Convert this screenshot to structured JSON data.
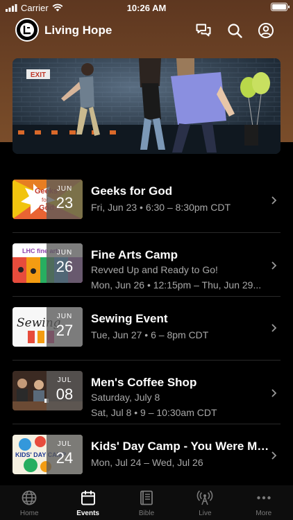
{
  "status_bar": {
    "carrier": "Carrier",
    "time": "10:26 AM"
  },
  "app": {
    "title": "Living Hope"
  },
  "colors": {
    "header_brown": "#6e4426",
    "background": "#000000",
    "muted_text": "#a8a8a8",
    "active_tab": "#ffffff"
  },
  "hero": {
    "exit_sign": "EXIT"
  },
  "events": [
    {
      "title": "Geeks for God",
      "month": "JUN",
      "day": "23",
      "lines": [
        "Fri, Jun 23 • 6:30 – 8:30pm CDT"
      ],
      "thumb_text": "Geeks for God"
    },
    {
      "title": "Fine Arts Camp",
      "month": "JUN",
      "day": "26",
      "lines": [
        "Revved Up and Ready to Go!",
        "Mon, Jun 26 • 12:15pm – Thu, Jun 29..."
      ],
      "thumb_text": "LHC fine arts"
    },
    {
      "title": "Sewing Event",
      "month": "JUN",
      "day": "27",
      "lines": [
        "Tue, Jun 27 • 6 – 8pm CDT"
      ],
      "thumb_text": "Sewing"
    },
    {
      "title": "Men's Coffee Shop",
      "month": "JUL",
      "day": "08",
      "lines": [
        "Saturday, July 8",
        "Sat, Jul 8 • 9 – 10:30am CDT"
      ],
      "thumb_text": ""
    },
    {
      "title": "Kids' Day Camp - You Were Ma...",
      "month": "JUL",
      "day": "24",
      "lines": [
        "Mon, Jul 24 – Wed, Jul 26"
      ],
      "thumb_text": "KIDS' DAY CAMP"
    }
  ],
  "tabs": [
    {
      "label": "Home",
      "icon": "globe-icon",
      "active": false
    },
    {
      "label": "Events",
      "icon": "calendar-icon",
      "active": true
    },
    {
      "label": "Bible",
      "icon": "bible-icon",
      "active": false
    },
    {
      "label": "Live",
      "icon": "broadcast-icon",
      "active": false
    },
    {
      "label": "More",
      "icon": "more-icon",
      "active": false
    }
  ]
}
